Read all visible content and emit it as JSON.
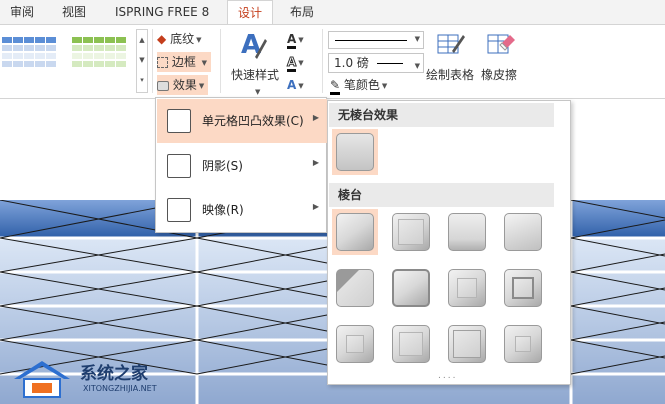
{
  "tabs": [
    {
      "label": "审阅",
      "active": false
    },
    {
      "label": "视图",
      "active": false
    },
    {
      "label": "ISPRING FREE 8",
      "active": false
    },
    {
      "label": "设计",
      "active": true
    },
    {
      "label": "布局",
      "active": false
    }
  ],
  "ribbon": {
    "shading_label": "底纹",
    "borders_label": "边框",
    "effects_label": "效果",
    "quick_styles_label": "快速样式",
    "pen_weight_value": "1.0 磅",
    "pen_color_label": "笔颜色",
    "draw_table_label": "绘制表格",
    "eraser_label": "橡皮擦"
  },
  "effects_menu": {
    "items": [
      {
        "label": "单元格凹凸效果(C)",
        "highlighted": true
      },
      {
        "label": "阴影(S)",
        "highlighted": false
      },
      {
        "label": "映像(R)",
        "highlighted": false
      }
    ]
  },
  "bevel_gallery": {
    "no_bevel_header": "无棱台效果",
    "bevel_header": "棱台",
    "more_indicator": "....",
    "bevel_icons": [
      "circle-bevel-icon",
      "relaxed-inset-bevel-icon",
      "cross-bevel-icon",
      "cool-slant-bevel-icon",
      "angle-bevel-icon",
      "soft-round-bevel-icon",
      "convex-bevel-icon",
      "slope-bevel-icon",
      "divot-bevel-icon",
      "riblet-bevel-icon",
      "hard-edge-bevel-icon",
      "art-deco-bevel-icon"
    ]
  },
  "watermark": {
    "title": "系统之家",
    "subtitle": "XITONGZHIJIA.NET"
  },
  "colors": {
    "accent": "#c43e1c",
    "highlight": "#fcd9c5",
    "table_blue": "#3f6fb5"
  }
}
